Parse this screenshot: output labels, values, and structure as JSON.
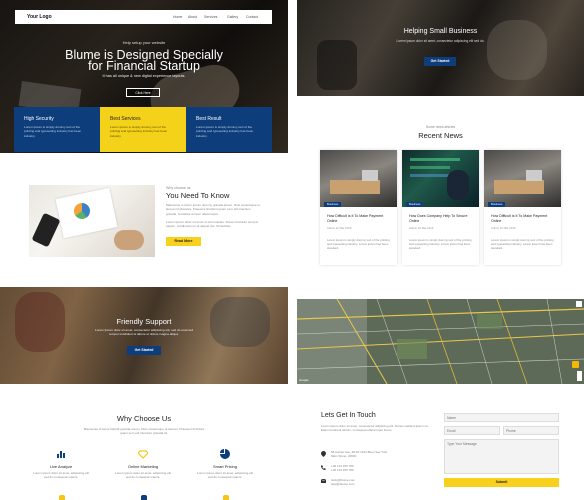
{
  "header": {
    "logo": "Your Logo",
    "nav": [
      "Home",
      "About",
      "Services",
      "Gallery",
      "Contact"
    ]
  },
  "hero": {
    "kicker": "Help setup your website",
    "title_line1": "Blume is Designed Specially",
    "title_line2": "for Financial Startup",
    "subtitle": "It has all unique & new digital experience layouts.",
    "button": "Click Here"
  },
  "features": [
    {
      "title": "High Security",
      "text": "Lorem ipsum is simply dummy text of the printing and typesetting industry has been industry."
    },
    {
      "title": "Best Services",
      "text": "Lorem ipsum is simply dummy text of the printing and typesetting industry has been industry."
    },
    {
      "title": "Best Result",
      "text": "Lorem ipsum is simply dummy text of the printing and typesetting industry has been industry."
    }
  ],
  "needs": {
    "kicker": "Why choose us",
    "title": "You Need To Know",
    "para1": "Maecenas is lorem ipsum dummy gravida ipsum. Duis scelerisque ut laoreet id pharetra. Praesent tincidunt quam sem elit interdum gravida. Curabitur tempor ullamcorper.",
    "para2": "Lorem ipsum dolor sit amet ut elit molestie. Donec tincidunt tempus sapien, condimentum sit aliquet dui. Sit facilisis.",
    "button": "Read More"
  },
  "friendly": {
    "title": "Friendly Support",
    "text": "Lorem ipsum dolor sit amet, consectetur adipiscing elit, sed do eiusmod tempor incididunt ut labore et dolore magna aliqua.",
    "button": "Get Started"
  },
  "choose": {
    "title": "Why Choose Us",
    "text": "Maecenas id lacus blandit gravida ipsum. Duis scelerisque ut laoreet. Praesent tincidunt quam sem elit interdum gravida sit.",
    "items": [
      {
        "icon": "chart-icon",
        "title": "Live Analyze",
        "text": "Lorem ipsum dolor sit amet, adipiscing elit sed do consequat mauris."
      },
      {
        "icon": "diamond-icon",
        "title": "Online Marketing",
        "text": "Lorem ipsum dolor sit amet, adipiscing elit sed do consequat mauris."
      },
      {
        "icon": "pie-icon",
        "title": "Smart Pricing",
        "text": "Lorem ipsum dolor sit amet, adipiscing elit sed do consequat mauris."
      }
    ]
  },
  "smallbiz": {
    "title": "Helping Small Business",
    "text": "Lorem ipsum dolor sit amet, consectetur adipiscing elit sed do.",
    "button": "Get Started"
  },
  "news": {
    "kicker": "Some news articles",
    "title": "Recent News",
    "posts": [
      {
        "tag": "Business",
        "title": "How Difficult is It To Make Payment Online",
        "meta": "Admin  12 Mar 2019",
        "text": "Lorem ipsum is simply dummy text of the printing and typesetting industry. Lorem ipsum has been standard."
      },
      {
        "tag": "Business",
        "title": "How Does Company Help To Secure Online",
        "meta": "Admin  12 Mar 2019",
        "text": "Lorem ipsum is simply dummy text of the printing and typesetting industry. Lorem ipsum has been standard."
      },
      {
        "tag": "Business",
        "title": "How Difficult is It To Make Payment Online",
        "meta": "Admin  12 Mar 2019",
        "text": "Lorem ipsum is simply dummy text of the printing and typesetting industry. Lorem ipsum has been standard."
      }
    ]
  },
  "map": {
    "credit": "Google"
  },
  "contact": {
    "title": "Lets Get In Touch",
    "text": "Lorem ipsum dolor sit amet, consectetur adipiscing elit. Donec eleifend ipsum sit. Etiam hendrerit dictum, consequat ullamcorper lorem.",
    "address": "68 Harriet Ave, 68-60 1234 Blue New York Main Street, 20000",
    "phone": "+00 123 456 789\n+00 123 456 789",
    "email": "hello@blume.com\nhelp@blume.com",
    "placeholders": {
      "name": "Name",
      "email": "Email",
      "phone": "Phone",
      "message": "Type Your Message"
    },
    "button": "Submit"
  }
}
